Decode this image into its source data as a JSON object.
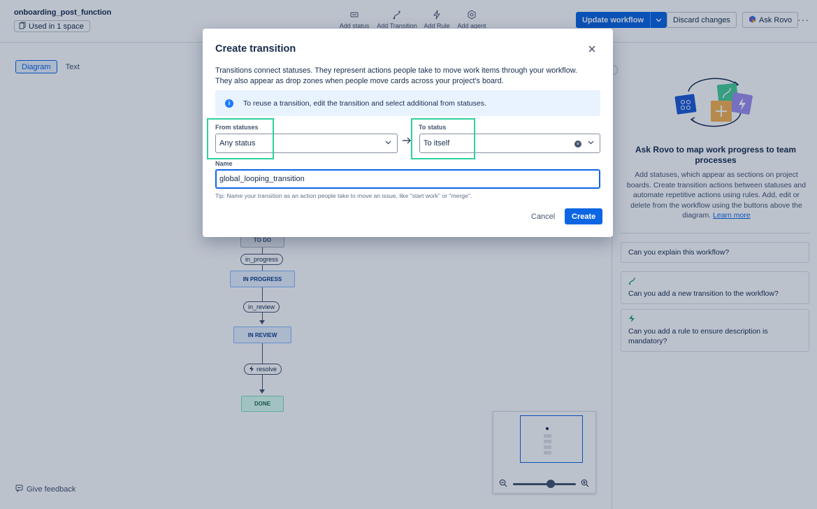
{
  "header": {
    "workflow_name": "onboarding_post_function",
    "used_in": "Used in 1 space",
    "tools": [
      {
        "label": "Add status",
        "icon": "status-icon"
      },
      {
        "label": "Add Transition",
        "icon": "transition-icon"
      },
      {
        "label": "Add Rule",
        "icon": "rule-icon"
      },
      {
        "label": "Add agent",
        "icon": "agent-icon"
      }
    ],
    "update_button": "Update workflow",
    "discard_button": "Discard changes",
    "ask_rovo_button": "Ask Rovo",
    "more": "···"
  },
  "canvas": {
    "view_tabs": [
      "Diagram",
      "Text"
    ],
    "active_tab": "Diagram",
    "statuses": {
      "todo": "TO DO",
      "in_progress": "IN PROGRESS",
      "in_review": "IN REVIEW",
      "done": "DONE"
    },
    "transitions": {
      "to_progress": "in_progress",
      "to_review": "in_review",
      "resolve": "resolve"
    },
    "feedback": "Give feedback"
  },
  "right_panel": {
    "heading": "Ask Rovo to map work progress to team processes",
    "body": "Add statuses, which appear as sections on project boards. Create transition actions between statuses and automate repetitive actions using rules. Add, edit or delete from the workflow using the buttons above the diagram.",
    "learn_more": "Learn more",
    "suggestions": [
      "Can you explain this workflow?",
      "Can you add a new transition to the workflow?",
      "Can you add a rule to ensure description is mandatory?"
    ]
  },
  "modal": {
    "title": "Create transition",
    "description_line1": "Transitions connect statuses. They represent actions people take to move work items through your workflow.",
    "description_line2": "They also appear as drop zones when people move cards across your project's board.",
    "info": "To reuse a transition, edit the transition and select additional from statuses.",
    "from_label": "From statuses",
    "from_value": "Any status",
    "to_label": "To status",
    "to_value": "To itself",
    "name_label": "Name",
    "name_value": "global_looping_transition",
    "tip": "Tip: Name your transition as an action people take to move an issue, like \"start work\" or \"merge\".",
    "cancel": "Cancel",
    "create": "Create"
  },
  "colors": {
    "primary": "#0c66e4",
    "highlight": "#2ed1a0",
    "overlay": "rgba(9,30,66,0.27)"
  }
}
